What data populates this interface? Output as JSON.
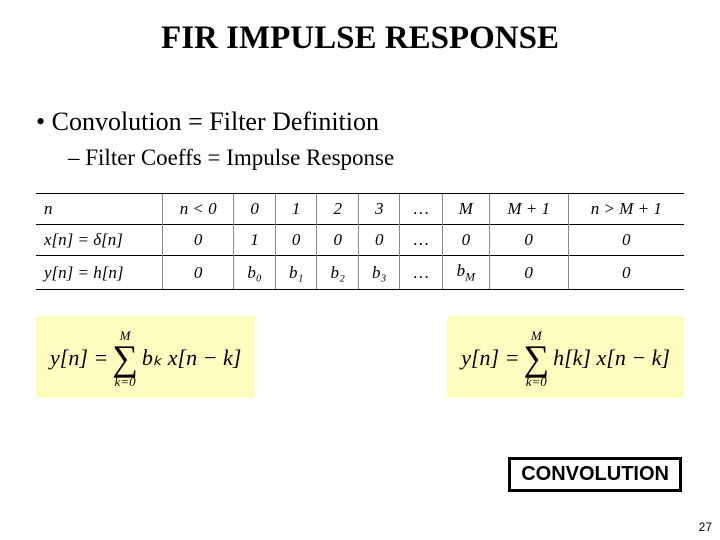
{
  "title": "FIR IMPULSE RESPONSE",
  "bullet1": "Convolution = Filter Definition",
  "bullet2": "Filter Coeffs = Impulse Response",
  "table": {
    "row1_label": "n",
    "row2_label": "x[n] = δ[n]",
    "row3_label": "y[n] = h[n]",
    "cols": {
      "c0": "n < 0",
      "c1": "0",
      "c2": "1",
      "c3": "2",
      "c4": "3",
      "c5": "…",
      "c6": "M",
      "c7": "M + 1",
      "c8": "n > M + 1"
    },
    "row2": {
      "c0": "0",
      "c1": "1",
      "c2": "0",
      "c3": "0",
      "c4": "0",
      "c5": "…",
      "c6": "0",
      "c7": "0",
      "c8": "0"
    },
    "row3": {
      "c0": "0",
      "c1": "b₀",
      "c2": "b₁",
      "c3": "b₂",
      "c4": "b₃",
      "c5": "…",
      "c6": "b_M",
      "c7": "0",
      "c8": "0"
    }
  },
  "eq1": {
    "lhs": "y[n] =",
    "upper": "M",
    "lower": "k=0",
    "rhs": "bₖ x[n − k]"
  },
  "eq2": {
    "lhs": "y[n] =",
    "upper": "M",
    "lower": "k=0",
    "rhs": "h[k] x[n − k]"
  },
  "conv_label": "CONVOLUTION",
  "page_number": "27"
}
